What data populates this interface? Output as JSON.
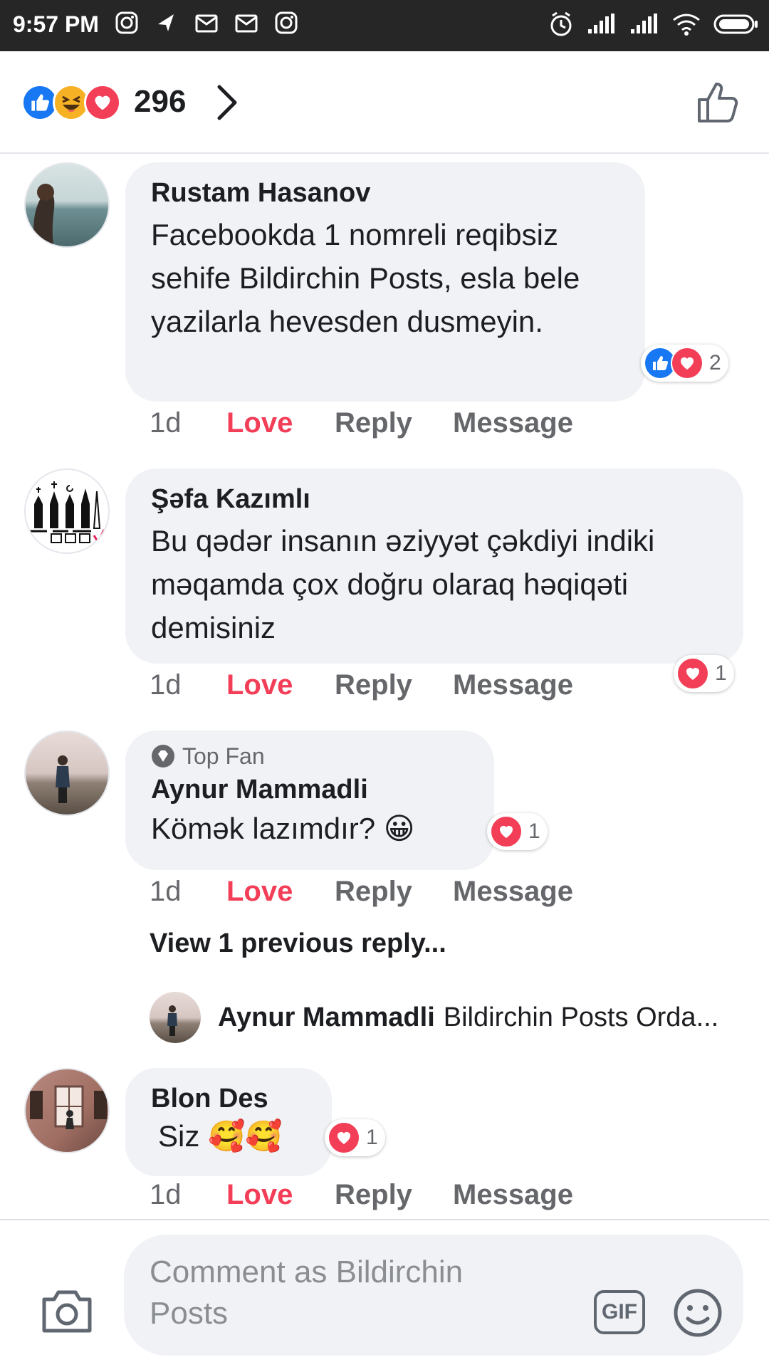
{
  "status_bar": {
    "time": "9:57 PM"
  },
  "reactions_header": {
    "count": "296",
    "types": [
      "like",
      "haha",
      "love"
    ]
  },
  "comments": [
    {
      "author": "Rustam Hasanov",
      "text": "Facebookda 1 nomreli reqibsiz sehife Bildirchin Posts, esla bele yazilarla hevesden dusmeyin.",
      "reaction_count": "2",
      "time": "1d"
    },
    {
      "author": "Şəfa Kazımlı",
      "text": "Bu qədər insanın əziyyət çəkdiyi indiki məqamda çox doğru olaraq həqiqəti demisiniz",
      "reaction_count": "1",
      "time": "1d"
    },
    {
      "badge": "Top Fan",
      "author": "Aynur Mammadli",
      "text": "Kömək lazımdır? 😀",
      "reaction_count": "1",
      "time": "1d"
    },
    {
      "author": "Blon Des",
      "text": "Siz 🥰🥰",
      "reaction_count": "1",
      "time": "1d"
    }
  ],
  "actions": {
    "love": "Love",
    "reply": "Reply",
    "message": "Message"
  },
  "view_previous": "View 1 previous reply...",
  "reply_preview": {
    "author": "Aynur Mammadli",
    "text": "Bildirchin Posts Orda..."
  },
  "composer": {
    "placeholder": "Comment as Bildirchin Posts",
    "gif_label": "GIF"
  },
  "colors": {
    "love": "#f33e58",
    "like": "#1877f2",
    "muted": "#65676b",
    "bubble": "#f0f2f5"
  }
}
